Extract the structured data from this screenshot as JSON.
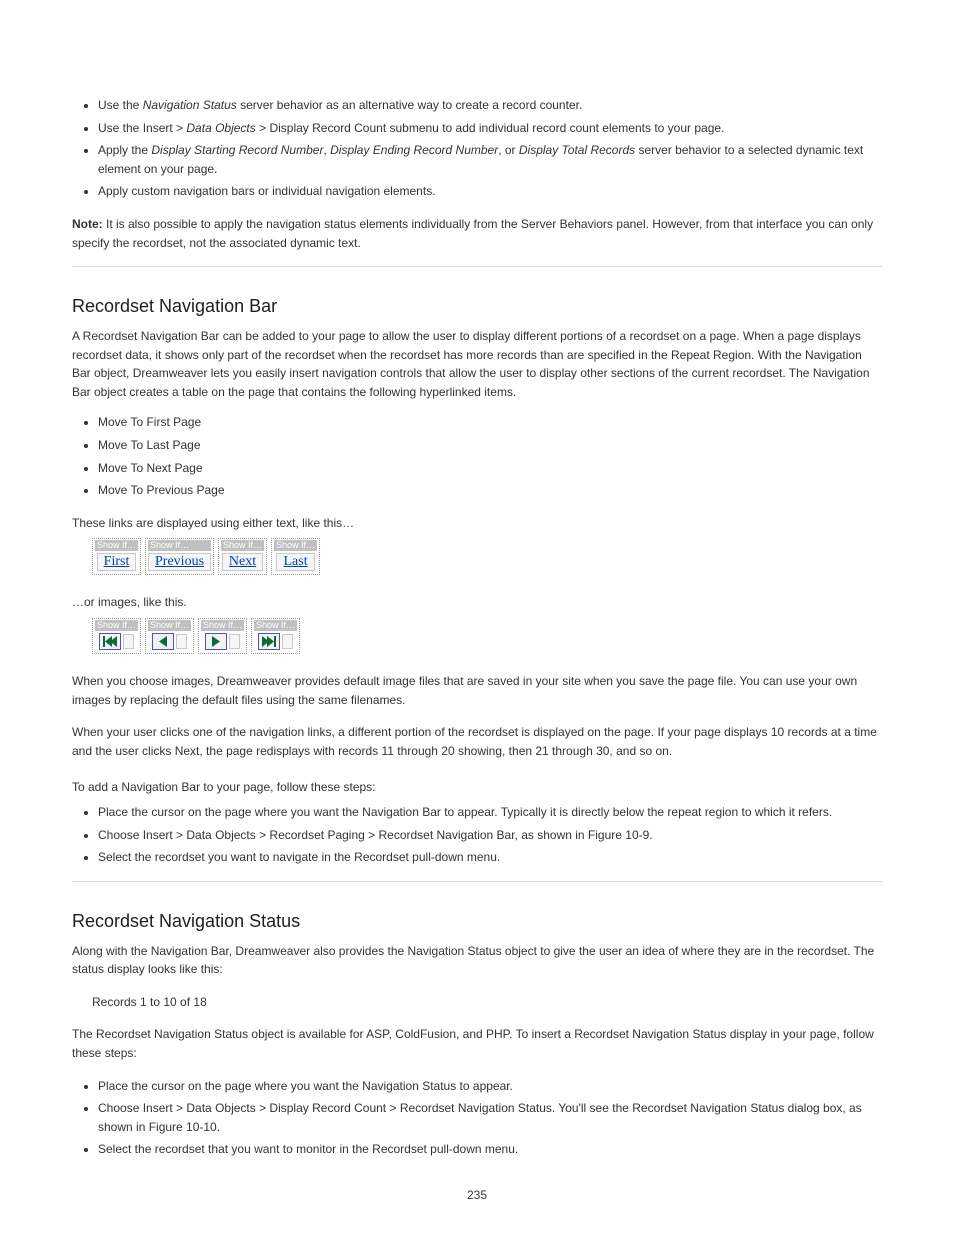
{
  "intro_bullets": {
    "b1_prefix": "Use the ",
    "b1_em": "Navigation Status ",
    "b1_suffix": "server behavior as an alternative way to create a record counter.",
    "b2_prefix": "Use the Insert > ",
    "b2_em": "Data Objects",
    "b2_suffix": " > Display Record Count submenu to add individual record count elements to your page.",
    "b3_prefix": "Apply the ",
    "b3_em": "Display Starting Record Number",
    "b3_mid": ", ",
    "b3_em2": "Display Ending Record Number",
    "b3_mid2": ", or ",
    "b3_em3": "Display Total Records",
    "b3_suffix": " server behavior to a selected dynamic text element on your page.",
    "b4": "Apply custom navigation bars or individual navigation elements."
  },
  "note": {
    "label": "Note: ",
    "text": "It is also possible to apply the navigation status elements individually from the Server Behaviors panel. However, from that interface you can only specify the recordset, not the associated dynamic text."
  },
  "nav": {
    "title": "Recordset Navigation Bar",
    "lead_1": "A Recordset Navigation Bar can be added to your page to allow the user to display different portions of a recordset on a page. When a page displays recordset data, it shows only part of the recordset when the recordset has more records than are specified in the Repeat Region. With the Navigation Bar object, Dreamweaver lets you easily insert navigation controls that allow the user to display other sections of the current recordset. The Navigation Bar object creates a table on the page that contains the following hyperlinked items.",
    "bullets": [
      "Move To First Page",
      "Move To Last Page",
      "Move To Next Page",
      "Move To Previous Page"
    ],
    "caption_text": "These links are displayed using either text, like this…",
    "caption_image": "…or images, like this.",
    "para_after_1": "When you choose images, Dreamweaver provides default image files that are saved in your site when you save the page file. You can use your own images by replacing the default files using the same filenames.",
    "para_after_2": "When your user clicks one of the navigation links, a different portion of the recordset is displayed on the page. If your page displays 10 records at a time and the user clicks Next, the page redisplays with records 11 through 20 showing, then 21 through 30, and so on.",
    "proc_label": "To add a Navigation Bar to your page, follow these steps:",
    "cells": {
      "label": "Show If…",
      "first": "First",
      "previous": "Previous",
      "next": "Next",
      "last": "Last"
    }
  },
  "proc": {
    "s1": "Place the cursor on the page where you want the Navigation Bar to appear. Typically it is directly below the repeat region to which it refers.",
    "s2": "Choose Insert > Data Objects > Recordset Paging > Recordset Navigation Bar, as shown in Figure 10-9.",
    "s3": "Select the recordset you want to navigate in the Recordset pull-down menu."
  },
  "status": {
    "title": "Recordset Navigation Status",
    "p1": "Along with the Navigation Bar, Dreamweaver also provides the Navigation Status object to give the user an idea of where they are in the recordset. The status display looks like this:",
    "sample": "Records 1 to 10 of 18",
    "p2": "The Recordset Navigation Status object is available for ASP, ColdFusion, and PHP. To insert a Recordset Navigation Status display in your page, follow these steps:",
    "bullets": [
      "Place the cursor on the page where you want the Navigation Status to appear.",
      "Choose Insert > Data Objects > Display Record Count > Recordset Navigation Status. You'll see the Recordset Navigation Status dialog box, as shown in Figure 10-10.",
      "Select the recordset that you want to monitor in the Recordset pull-down menu."
    ]
  },
  "page_number": "235"
}
